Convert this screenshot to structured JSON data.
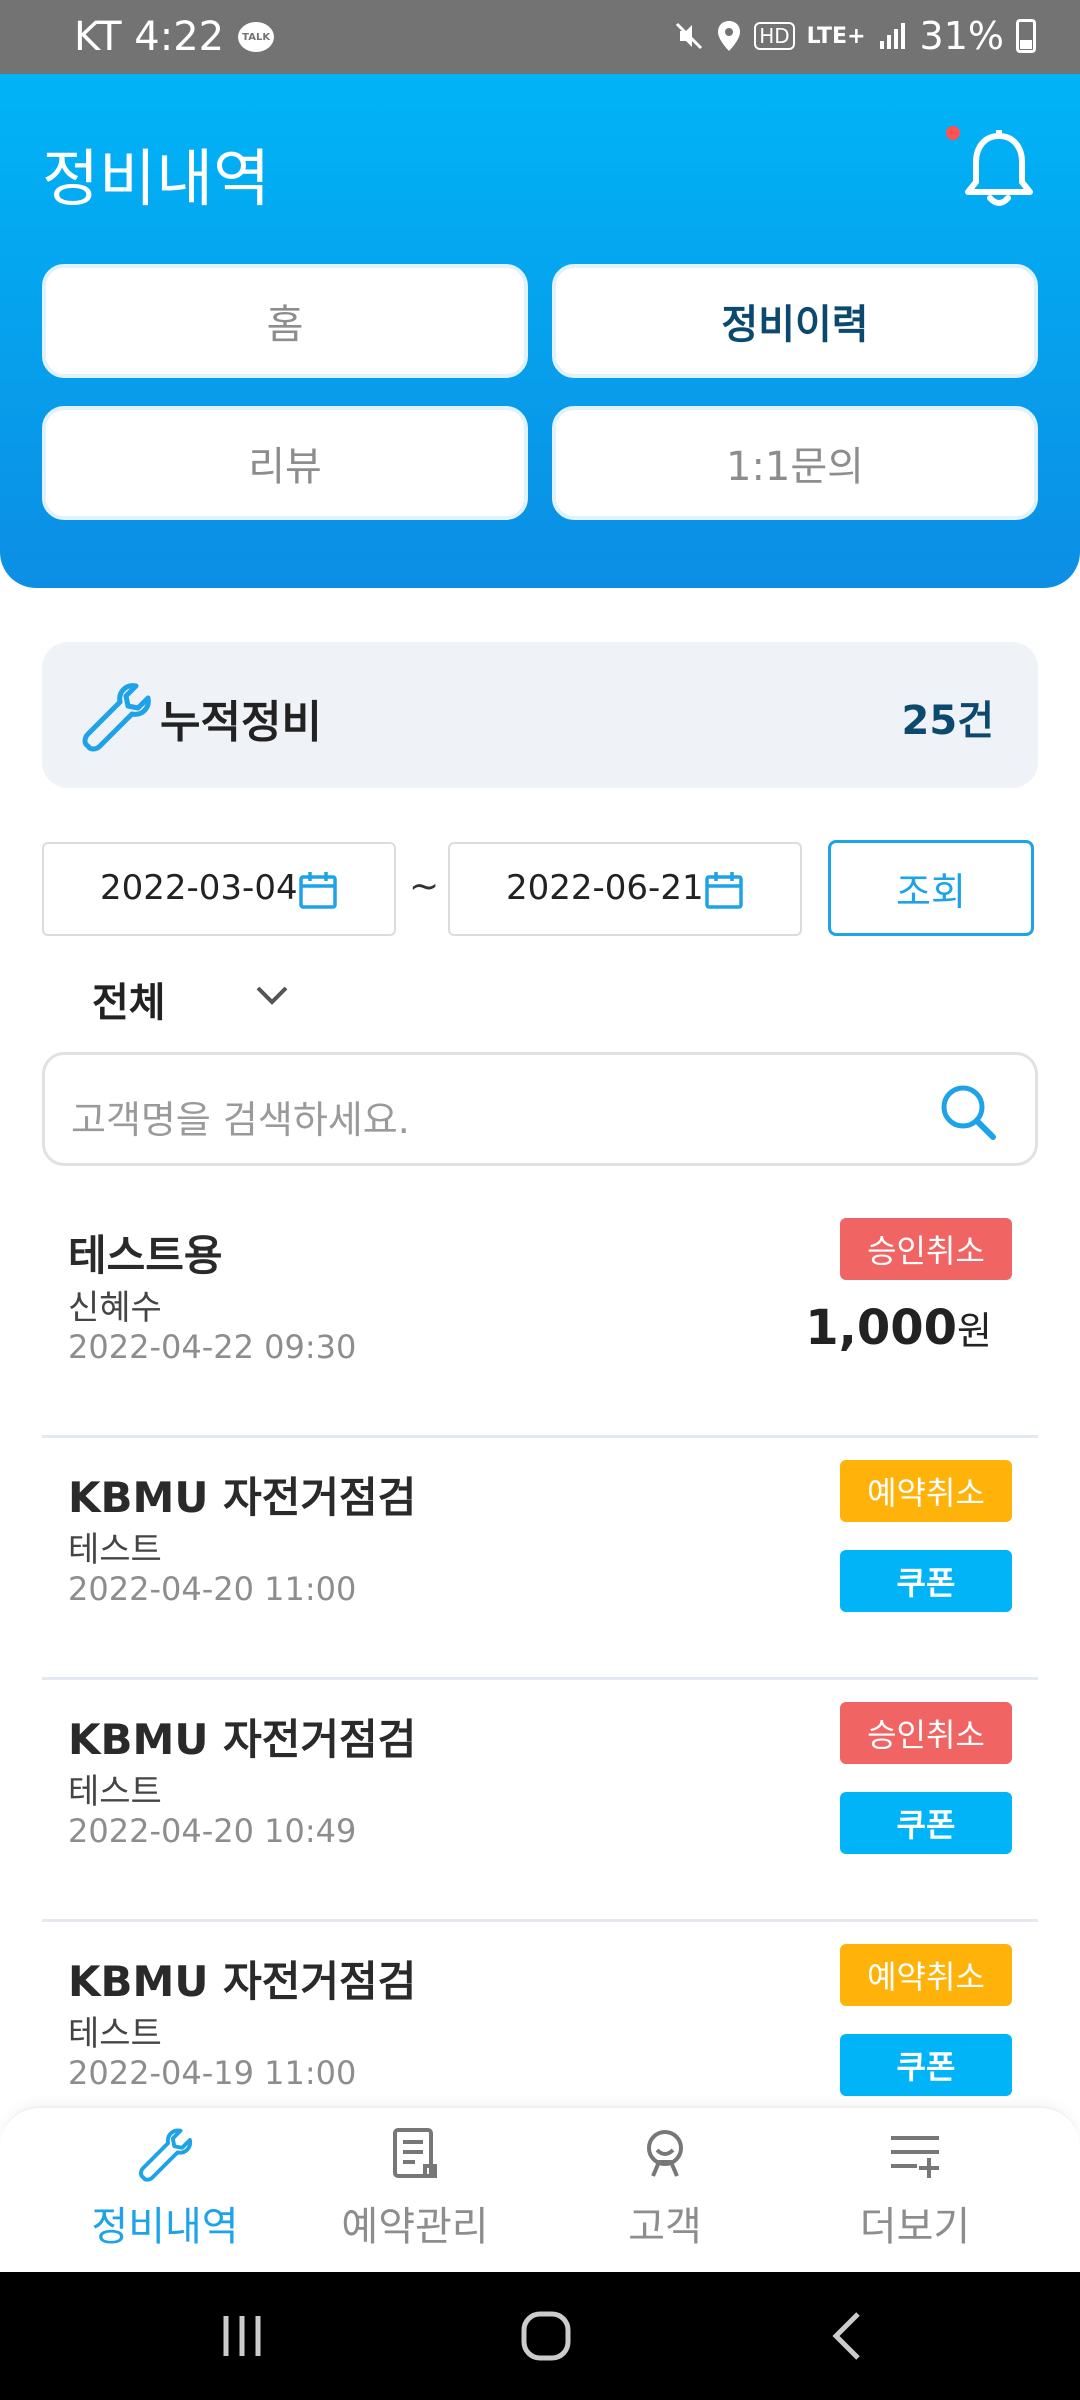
{
  "status_bar": {
    "carrier_time": "KT 4:22",
    "talk_badge": "TALK",
    "hd": "HD",
    "lte": "LTE+",
    "battery": "31%",
    "icons": [
      "kakaotalk-icon",
      "mute-icon",
      "location-icon",
      "hd-icon",
      "lte-icon",
      "signal-icon",
      "battery-icon"
    ]
  },
  "header": {
    "title": "정비내역",
    "notification_icon": "bell-icon",
    "tabs": [
      {
        "label": "홈",
        "active": false
      },
      {
        "label": "정비이력",
        "active": true
      },
      {
        "label": "리뷰",
        "active": false
      },
      {
        "label": "1:1문의",
        "active": false
      }
    ]
  },
  "summary": {
    "icon": "wrench-icon",
    "label": "누적정비",
    "count": "25건"
  },
  "filters": {
    "start_date": "2022-03-04",
    "end_date": "2022-06-21",
    "separator": "~",
    "query_label": "조회",
    "select_value": "전체",
    "search_placeholder": "고객명을 검색하세요."
  },
  "list": [
    {
      "title": "테스트용",
      "sub": "신혜수",
      "date": "2022-04-22 09:30",
      "status": "승인취소",
      "status_color": "#f06464",
      "price_value": "1,000",
      "price_unit": "원"
    },
    {
      "title": "KBMU 자전거점검",
      "sub": "테스트",
      "date": "2022-04-20 11:00",
      "status": "예약취소",
      "status_color": "#ffb30a",
      "coupon": "쿠폰"
    },
    {
      "title": "KBMU 자전거점검",
      "sub": "테스트",
      "date": "2022-04-20 10:49",
      "status": "승인취소",
      "status_color": "#f06464",
      "coupon": "쿠폰"
    },
    {
      "title": "KBMU 자전거점검",
      "sub": "테스트",
      "date": "2022-04-19 11:00",
      "status": "예약취소",
      "status_color": "#ffb30a",
      "coupon": "쿠폰"
    }
  ],
  "bottom_nav": [
    {
      "label": "정비내역",
      "icon": "wrench-icon",
      "active": true
    },
    {
      "label": "예약관리",
      "icon": "document-icon",
      "active": false
    },
    {
      "label": "고객",
      "icon": "customer-icon",
      "active": false
    },
    {
      "label": "더보기",
      "icon": "more-list-icon",
      "active": false
    }
  ],
  "colors": {
    "header_gradient_top": "#00b4f7",
    "header_gradient_bottom": "#0c8ee4",
    "accent": "#1ea2e8",
    "dark_text": "#0b4a6e",
    "badge_red": "#f06464",
    "badge_orange": "#ffb30a",
    "badge_blue": "#00b4f7"
  }
}
